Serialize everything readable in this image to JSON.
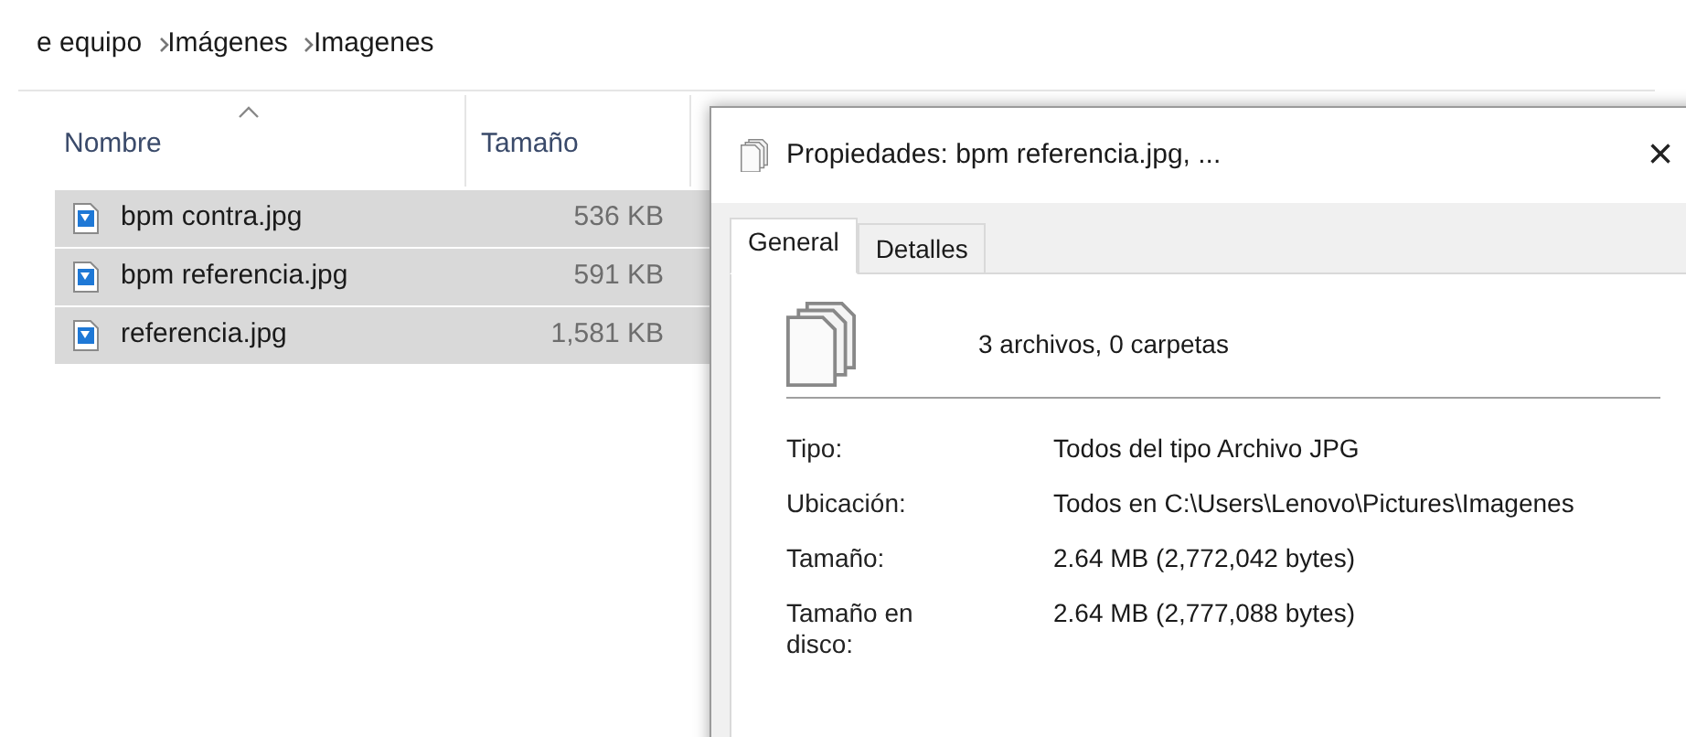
{
  "breadcrumb": [
    "e equipo",
    "Imágenes",
    "Imagenes"
  ],
  "columns": [
    {
      "label": "Nombre",
      "sorted": true
    },
    {
      "label": "Tamaño",
      "sorted": false
    }
  ],
  "files": [
    {
      "name": "bpm contra.jpg",
      "size": "536 KB",
      "selected": true
    },
    {
      "name": "bpm referencia.jpg",
      "size": "591 KB",
      "selected": true
    },
    {
      "name": "referencia.jpg",
      "size": "1,581 KB",
      "selected": true
    }
  ],
  "dialog": {
    "title": "Propiedades: bpm referencia.jpg, ...",
    "close": "×",
    "tabs": [
      {
        "label": "General",
        "selected": true
      },
      {
        "label": "Detalles",
        "selected": false
      }
    ],
    "summary": "3 archivos, 0 carpetas",
    "properties": [
      {
        "label": "Tipo:",
        "value": "Todos del tipo Archivo JPG"
      },
      {
        "label": "Ubicación:",
        "value": "Todos en C:\\Users\\Lenovo\\Pictures\\Imagenes"
      },
      {
        "label": "Tamaño:",
        "value": "2.64 MB (2,772,042 bytes)"
      },
      {
        "label": "Tamaño en disco:",
        "value": "2.64 MB (2,777,088 bytes)"
      }
    ]
  }
}
